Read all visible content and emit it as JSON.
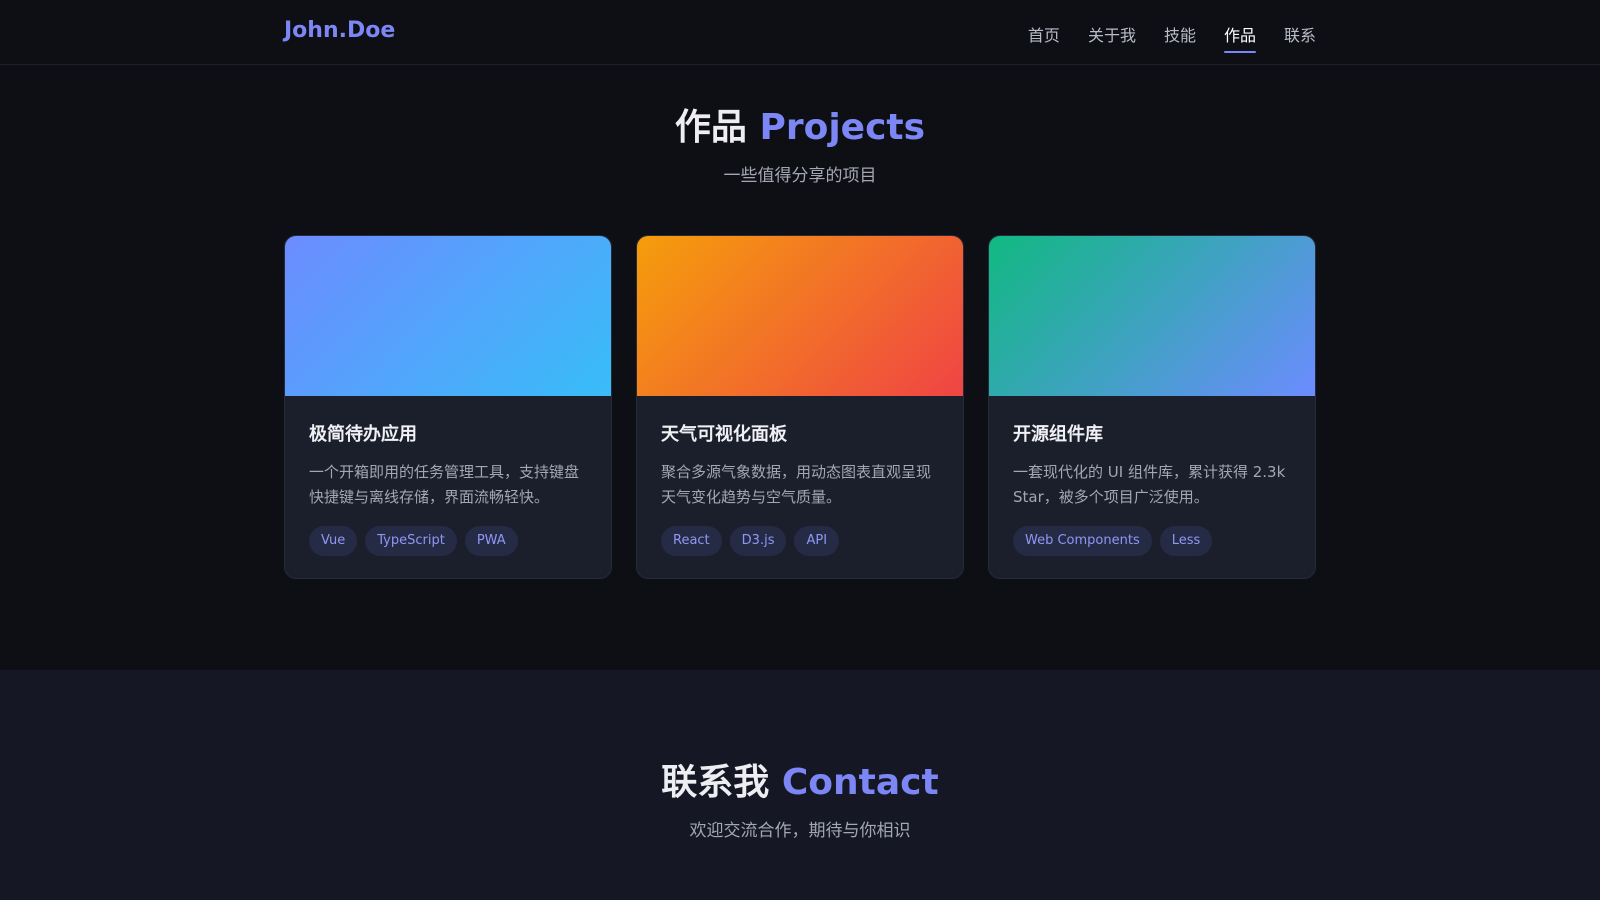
{
  "nav": {
    "logo": "John.Doe",
    "links": [
      "首页",
      "关于我",
      "技能",
      "作品",
      "联系"
    ],
    "active_index": 3
  },
  "projects": {
    "title_main": "作品",
    "title_accent": "Projects",
    "subtitle": "一些值得分享的项目",
    "cards": [
      {
        "title": "极简待办应用",
        "desc": "一个开箱即用的任务管理工具，支持键盘快捷键与离线存储，界面流畅轻快。",
        "tags": [
          "Vue",
          "TypeScript",
          "PWA"
        ],
        "gradient": [
          "#6c8cff",
          "#38bdf8"
        ]
      },
      {
        "title": "天气可视化面板",
        "desc": "聚合多源气象数据，用动态图表直观呈现天气变化趋势与空气质量。",
        "tags": [
          "React",
          "D3.js",
          "API"
        ],
        "gradient": [
          "#f59e0b",
          "#ef4444"
        ]
      },
      {
        "title": "开源组件库",
        "desc": "一套现代化的 UI 组件库，累计获得 2.3k Star，被多个项目广泛使用。",
        "tags": [
          "Web Components",
          "Less"
        ],
        "gradient": [
          "#10b981",
          "#6c8cff"
        ]
      }
    ]
  },
  "contact": {
    "title_main": "联系我",
    "title_accent": "Contact",
    "subtitle": "欢迎交流合作，期待与你相识"
  },
  "colors": {
    "accent": "#7c86f5",
    "background": "#0e0f14",
    "card": "#1b1e2b",
    "contact_bg": "#151824"
  }
}
